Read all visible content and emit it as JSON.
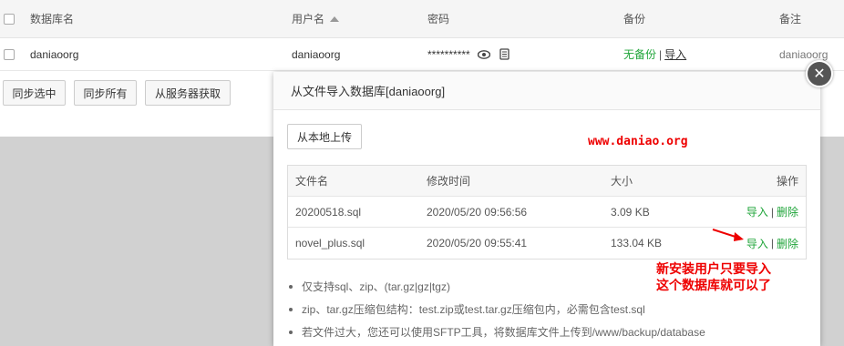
{
  "background_table": {
    "headers": {
      "name": "数据库名",
      "user": "用户名",
      "password": "密码",
      "backup": "备份",
      "remark": "备注"
    },
    "row": {
      "name": "daniaoorg",
      "user": "daniaoorg",
      "password": "**********",
      "backup_status": "无备份",
      "backup_sep": "|",
      "import_link": "导入",
      "remark": "daniaoorg"
    }
  },
  "toolbar": {
    "sync_selected": "同步选中",
    "sync_all": "同步所有",
    "fetch_from_server": "从服务器获取"
  },
  "dialog": {
    "title": "从文件导入数据库[daniaoorg]",
    "upload_button": "从本地上传",
    "watermark": "www.daniao.org",
    "table_headers": {
      "filename": "文件名",
      "mtime": "修改时间",
      "size": "大小",
      "ops": "操作"
    },
    "files": [
      {
        "filename": "20200518.sql",
        "mtime": "2020/05/20 09:56:56",
        "size": "3.09 KB",
        "import": "导入",
        "sep": "|",
        "delete": "删除"
      },
      {
        "filename": "novel_plus.sql",
        "mtime": "2020/05/20 09:55:41",
        "size": "133.04 KB",
        "import": "导入",
        "sep": "|",
        "delete": "删除"
      }
    ],
    "notes": [
      "仅支持sql、zip、(tar.gz|gz|tgz)",
      "zip、tar.gz压缩包结构：test.zip或test.tar.gz压缩包内，必需包含test.sql",
      "若文件过大，您还可以使用SFTP工具，将数据库文件上传到/www/backup/database"
    ],
    "annotation_line1": "新安装用户只要导入",
    "annotation_line2": "这个数据库就可以了",
    "close_symbol": "✕"
  },
  "colors": {
    "accent_green": "#20a53a",
    "annotation_red": "#e00000"
  }
}
